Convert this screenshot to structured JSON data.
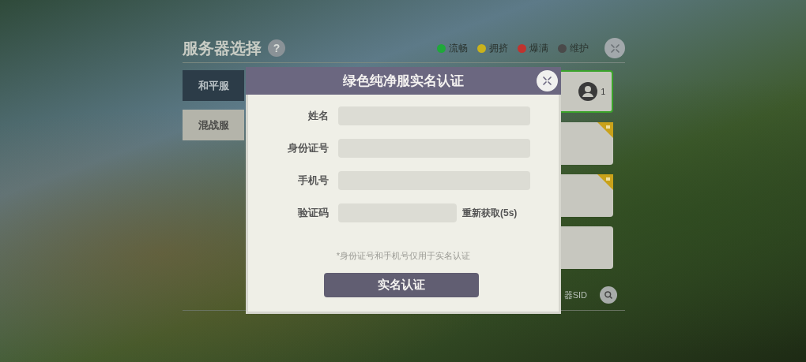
{
  "server_panel": {
    "title": "服务器选择",
    "help": "?",
    "legend": [
      {
        "label": "流畅",
        "color": "#1fa83a"
      },
      {
        "label": "拥挤",
        "color": "#c9b21c"
      },
      {
        "label": "爆满",
        "color": "#c0332e"
      },
      {
        "label": "维护",
        "color": "#4a4a4a"
      }
    ],
    "tabs": [
      {
        "label": "和平服",
        "selected": true
      },
      {
        "label": "混战服",
        "selected": false
      }
    ],
    "servers": [
      {
        "selected": true,
        "locked": false,
        "players": "1"
      },
      {
        "selected": false,
        "locked": true
      },
      {
        "selected": false,
        "locked": true
      },
      {
        "selected": false,
        "locked": false
      }
    ],
    "sid_search": "器SID"
  },
  "dialog": {
    "title": "绿色纯净服实名认证",
    "fields": [
      {
        "label": "姓名",
        "kind": "text"
      },
      {
        "label": "身份证号",
        "kind": "text"
      },
      {
        "label": "手机号",
        "kind": "text"
      },
      {
        "label": "验证码",
        "kind": "code",
        "action": "重新获取(5s)"
      }
    ],
    "note": "*身份证号和手机号仅用于实名认证",
    "submit": "实名认证"
  }
}
